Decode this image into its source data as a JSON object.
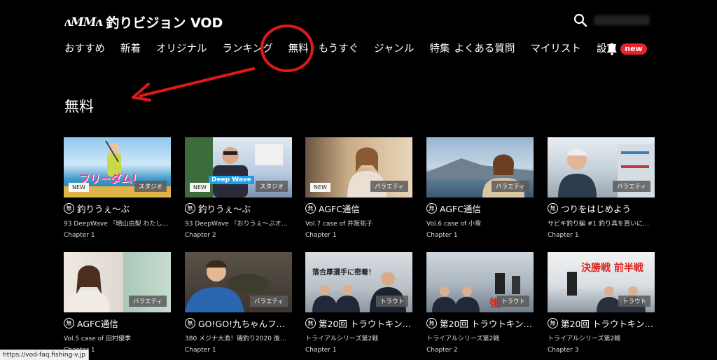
{
  "header": {
    "logo_mark": "ʌMMʌ",
    "logo_text": "釣りビジョン VOD"
  },
  "nav": {
    "items": [
      "おすすめ",
      "新着",
      "オリジナル",
      "ランキング",
      "無料",
      "もうすぐ",
      "ジャンル",
      "特集",
      "よくある質問",
      "マイリスト",
      "設定"
    ],
    "badge": "new"
  },
  "page": {
    "title": "無料"
  },
  "free_badge": "無",
  "cards": [
    {
      "title": "釣りうぇ〜ぶ",
      "sub": "93 DeepWave 「晴山由梨 わたし…",
      "chapter": "Chapter 1",
      "new": "NEW",
      "genre": "スタジオ"
    },
    {
      "title": "釣りうぇ〜ぶ",
      "sub": "93 DeepWave 『おりうぇ〜ぶオス…",
      "chapter": "Chapter 2",
      "new": "NEW",
      "genre": "スタジオ"
    },
    {
      "title": "AGFC通信",
      "sub": "Vol.7 case of 井阪祐子",
      "chapter": "Chapter 1",
      "new": "NEW",
      "genre": "バラエティ"
    },
    {
      "title": "AGFC通信",
      "sub": "Vol.6 case of 小雪",
      "chapter": "Chapter 1",
      "new": "",
      "genre": "バラエティ"
    },
    {
      "title": "つりをはじめよう",
      "sub": "サビキ釣り編 #1 釣り具を買いに行…",
      "chapter": "Chapter 1",
      "new": "",
      "genre": "バラエティ"
    },
    {
      "title": "AGFC通信",
      "sub": "Vol.5 case of 田村優季",
      "chapter": "Chapter 1",
      "new": "",
      "genre": "バラエティ"
    },
    {
      "title": "GO!GO!九ちゃんフィ…",
      "sub": "380 メジナ大漁！磯釣り2020 後篇 …",
      "chapter": "Chapter 1",
      "new": "",
      "genre": "バラエティ"
    },
    {
      "title": "第20回 トラウトキン…",
      "sub": "トライアルシリーズ第2戦",
      "chapter": "Chapter 1",
      "new": "",
      "genre": "トラウト"
    },
    {
      "title": "第20回 トラウトキン…",
      "sub": "トライアルシリーズ第2戦",
      "chapter": "Chapter 2",
      "new": "",
      "genre": "トラウト"
    },
    {
      "title": "第20回 トラウトキン…",
      "sub": "トライアルシリーズ第2戦",
      "chapter": "Chapter 3",
      "new": "",
      "genre": "トラウト"
    }
  ],
  "thumb_overlays": {
    "t0": "フリーダム！",
    "t1": "Deep Wave",
    "t7": "落合厚選手に密着！",
    "t9": "決勝戦 前半戦"
  },
  "statusbar": {
    "url": "https://vod-faq.fishing-v.jp"
  },
  "colors": {
    "accent": "#e8232a",
    "annotation": "#e01818"
  }
}
